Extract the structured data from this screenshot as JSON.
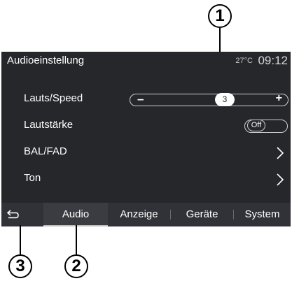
{
  "callouts": {
    "one": "1",
    "two": "2",
    "three": "3"
  },
  "header": {
    "title": "Audioeinstellung",
    "temperature": "27°C",
    "time": "09:12"
  },
  "settings": {
    "speed_volume": {
      "label": "Lauts/Speed",
      "minus_label": "–",
      "plus_label": "+",
      "value": "3",
      "level_fraction": 0.6
    },
    "volume": {
      "label": "Lautstärke",
      "toggle_value": "Off"
    },
    "bal_fad": {
      "label": "BAL/FAD"
    },
    "tone": {
      "label": "Ton"
    }
  },
  "tabs": [
    {
      "label": "Audio",
      "active": true
    },
    {
      "label": "Anzeige",
      "active": false
    },
    {
      "label": "Geräte",
      "active": false
    },
    {
      "label": "System",
      "active": false
    }
  ],
  "icons": {
    "back": "back-arrow-icon",
    "chevron": "chevron-right-icon"
  },
  "colors": {
    "screen_bg": "#26272b",
    "tabbar_bg": "#303237",
    "text": "#ffffff"
  }
}
